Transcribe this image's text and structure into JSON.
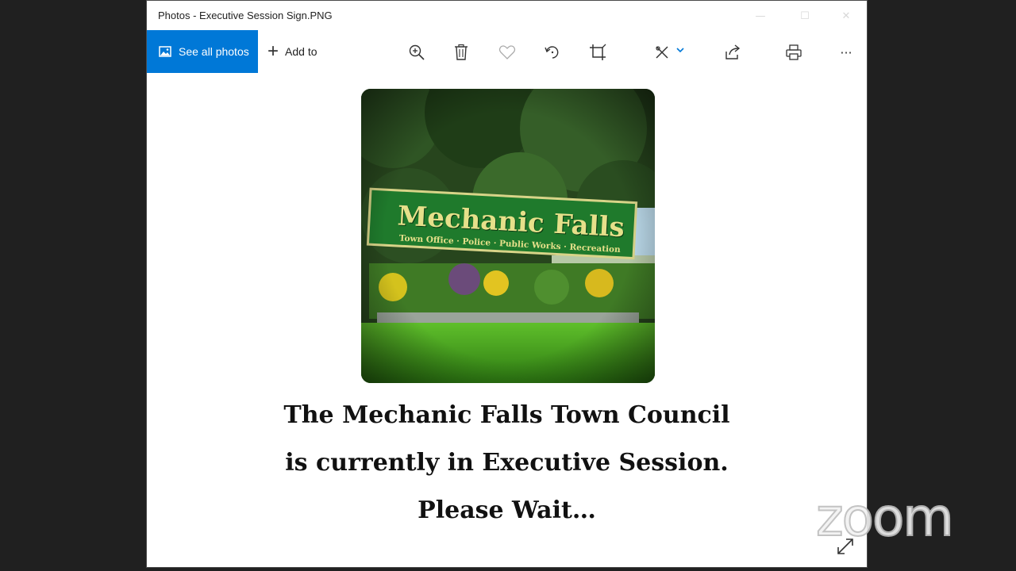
{
  "window": {
    "title": "Photos - Executive Session Sign.PNG",
    "controls": {
      "minimize": "—",
      "maximize": "☐",
      "close": "✕"
    }
  },
  "toolbar": {
    "see_all_label": "See all photos",
    "add_to_label": "Add to",
    "plus_glyph": "+",
    "icons": [
      "zoom-in-icon",
      "delete-icon",
      "favorite-icon",
      "rotate-icon",
      "crop-icon",
      "edit-draw-icon",
      "share-icon",
      "print-icon",
      "more-icon"
    ],
    "more_glyph": "···"
  },
  "photo": {
    "sign_title": "Mechanic Falls",
    "sign_subtitle": "Town Office · Police · Public Works · Recreation"
  },
  "caption": {
    "line1": "The Mechanic Falls Town Council",
    "line2": "is currently in Executive Session.",
    "line3": "Please Wait…"
  },
  "overlay": {
    "logo_text": "zoom"
  },
  "colors": {
    "accent": "#0078d7",
    "desktop_bg": "#202020",
    "sign_green": "#1f7a2c",
    "sign_text": "#e6e08a"
  }
}
